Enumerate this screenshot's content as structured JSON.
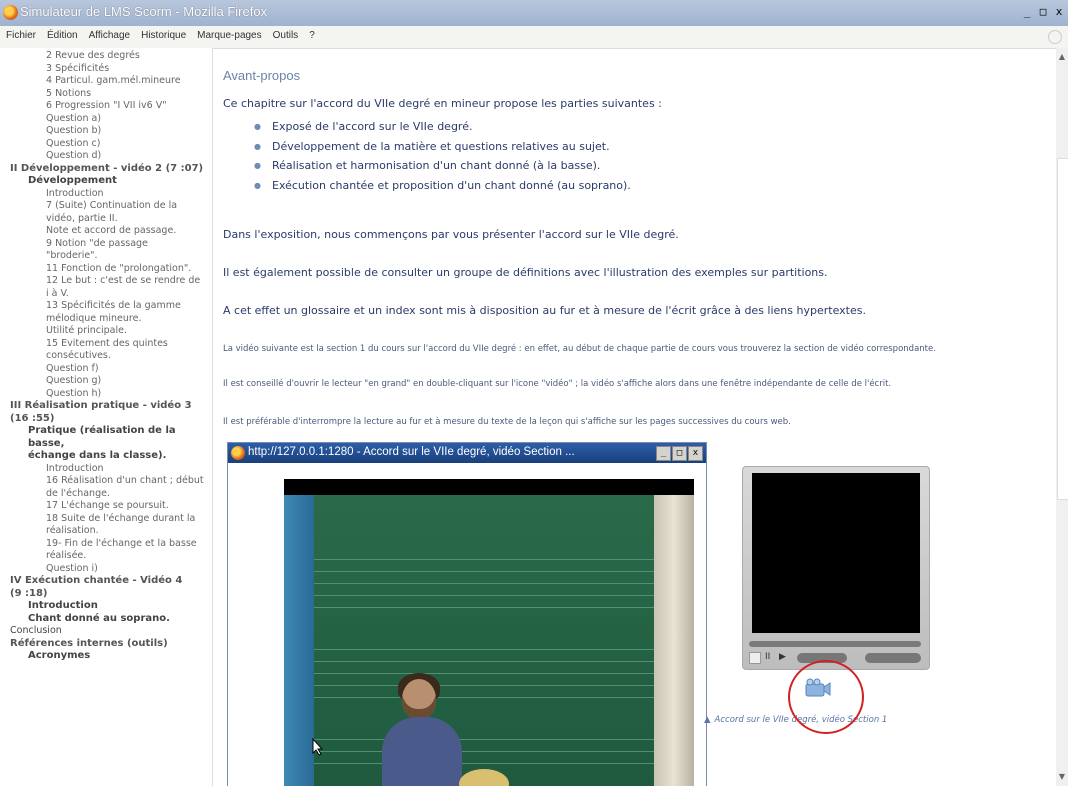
{
  "window": {
    "title": "Simulateur de LMS Scorm - Mozilla Firefox",
    "buttons": [
      "_",
      "□",
      "x"
    ]
  },
  "menu": [
    "Fichier",
    "Édition",
    "Affichage",
    "Historique",
    "Marque-pages",
    "Outils",
    "?"
  ],
  "toc": [
    {
      "level": "l2",
      "text": "2 Revue des degrés"
    },
    {
      "level": "l2",
      "text": "3 Spécificités"
    },
    {
      "level": "l2",
      "text": "4 Particul. gam.mél.mineure"
    },
    {
      "level": "l2",
      "text": "5 Notions"
    },
    {
      "level": "l2",
      "text": "6 Progression \"I VII iv6 V\""
    },
    {
      "level": "l2",
      "text": "Question a)"
    },
    {
      "level": "l2",
      "text": "Question b)"
    },
    {
      "level": "l2",
      "text": "Question c)"
    },
    {
      "level": "l2",
      "text": "Question d)"
    },
    {
      "level": "l0b",
      "text": "II Développement - vidéo 2 (7 :07)"
    },
    {
      "level": "l1",
      "text": "Développement"
    },
    {
      "level": "l2",
      "text": "Introduction"
    },
    {
      "level": "l2",
      "text": "7 (Suite) Continuation de la"
    },
    {
      "level": "l2",
      "text": "vidéo, partie II."
    },
    {
      "level": "l2",
      "text": "Note et accord de passage."
    },
    {
      "level": "l2",
      "text": "9 Notion \"de passage"
    },
    {
      "level": "l2",
      "text": "\"broderie\"."
    },
    {
      "level": "l2",
      "text": "11 Fonction de \"prolongation\"."
    },
    {
      "level": "l2",
      "text": "12 Le but : c'est de se rendre de"
    },
    {
      "level": "l2",
      "text": "i à V."
    },
    {
      "level": "l2",
      "text": "13 Spécificités de la gamme"
    },
    {
      "level": "l2",
      "text": "mélodique mineure."
    },
    {
      "level": "l2",
      "text": "Utilité principale."
    },
    {
      "level": "l2",
      "text": "15 Evitement des quintes"
    },
    {
      "level": "l2",
      "text": "consécutives."
    },
    {
      "level": "l2",
      "text": "Question f)"
    },
    {
      "level": "l2",
      "text": "Question g)"
    },
    {
      "level": "l2",
      "text": "Question h)"
    },
    {
      "level": "l0b",
      "text": "III Réalisation pratique - vidéo 3"
    },
    {
      "level": "l0b",
      "text": "(16 :55)"
    },
    {
      "level": "l1",
      "text": "Pratique (réalisation de la basse,"
    },
    {
      "level": "l1",
      "text": "échange dans la classe)."
    },
    {
      "level": "l2",
      "text": "Introduction"
    },
    {
      "level": "l2",
      "text": "16 Réalisation d'un chant ; début"
    },
    {
      "level": "l2",
      "text": "de l'échange."
    },
    {
      "level": "l2",
      "text": "17 L'échange se poursuit."
    },
    {
      "level": "l2",
      "text": "18 Suite de l'échange durant la"
    },
    {
      "level": "l2",
      "text": "réalisation."
    },
    {
      "level": "l2",
      "text": "19- Fin de l'échange et la basse"
    },
    {
      "level": "l2",
      "text": "réalisée."
    },
    {
      "level": "l2",
      "text": "Question i)"
    },
    {
      "level": "l0b",
      "text": "IV Exécution chantée - Vidéo 4"
    },
    {
      "level": "l0b",
      "text": "(9 :18)"
    },
    {
      "level": "l1",
      "text": "Introduction"
    },
    {
      "level": "l1",
      "text": "Chant donné au soprano."
    },
    {
      "level": "l0",
      "text": "Conclusion"
    },
    {
      "level": "l0b",
      "text": "Références internes (outils)"
    },
    {
      "level": "l1",
      "text": "Acronymes"
    }
  ],
  "main": {
    "heading": "Avant-propos",
    "intro": "Ce chapitre sur l'accord du VIIe degré en mineur propose les parties suivantes :",
    "bullets": [
      "Exposé de l'accord sur le VIIe degré.",
      "Développement de la matière et questions relatives au sujet.",
      "Réalisation et harmonisation d'un chant donné (à la basse).",
      "Exécution chantée et proposition d'un chant donné (au soprano)."
    ],
    "para1": "Dans l'exposition, nous commençons par vous présenter l'accord sur le VIIe degré.",
    "para2": "Il est également possible de consulter un groupe de définitions avec l'illustration des exemples sur partitions.",
    "para3": "A cet effet un glossaire et un index sont mis à disposition au fur et à mesure de l'écrit grâce à des liens hypertextes.",
    "small1": "La vidéo suivante est la section 1 du cours sur l'accord du VIIe degré : en effet, au début de chaque partie de cours vous trouverez la section de vidéo correspondante.",
    "small2": "Il est conseillé d'ouvrir le lecteur \"en grand\" en double-cliquant sur l'icone \"vidéo\" ; la vidéo s'affiche alors dans une fenêtre indépendante de celle de l'écrit.",
    "small3": "Il est préférable d'interrompre la lecture au fur et à mesure du texte de la leçon qui s'affiche sur les pages successives du cours web."
  },
  "popup": {
    "title": "http://127.0.0.1:1280 - Accord sur le VIIe degré, vidéo Section ...",
    "buttons": [
      "_",
      "□",
      "x"
    ]
  },
  "player": {
    "caption": "Accord sur le VIIe degré, vidéo Section 1"
  },
  "colors": {
    "titlebar": "#9fb2cf",
    "link": "#5a74a8",
    "highlight_circle": "#d42020"
  }
}
